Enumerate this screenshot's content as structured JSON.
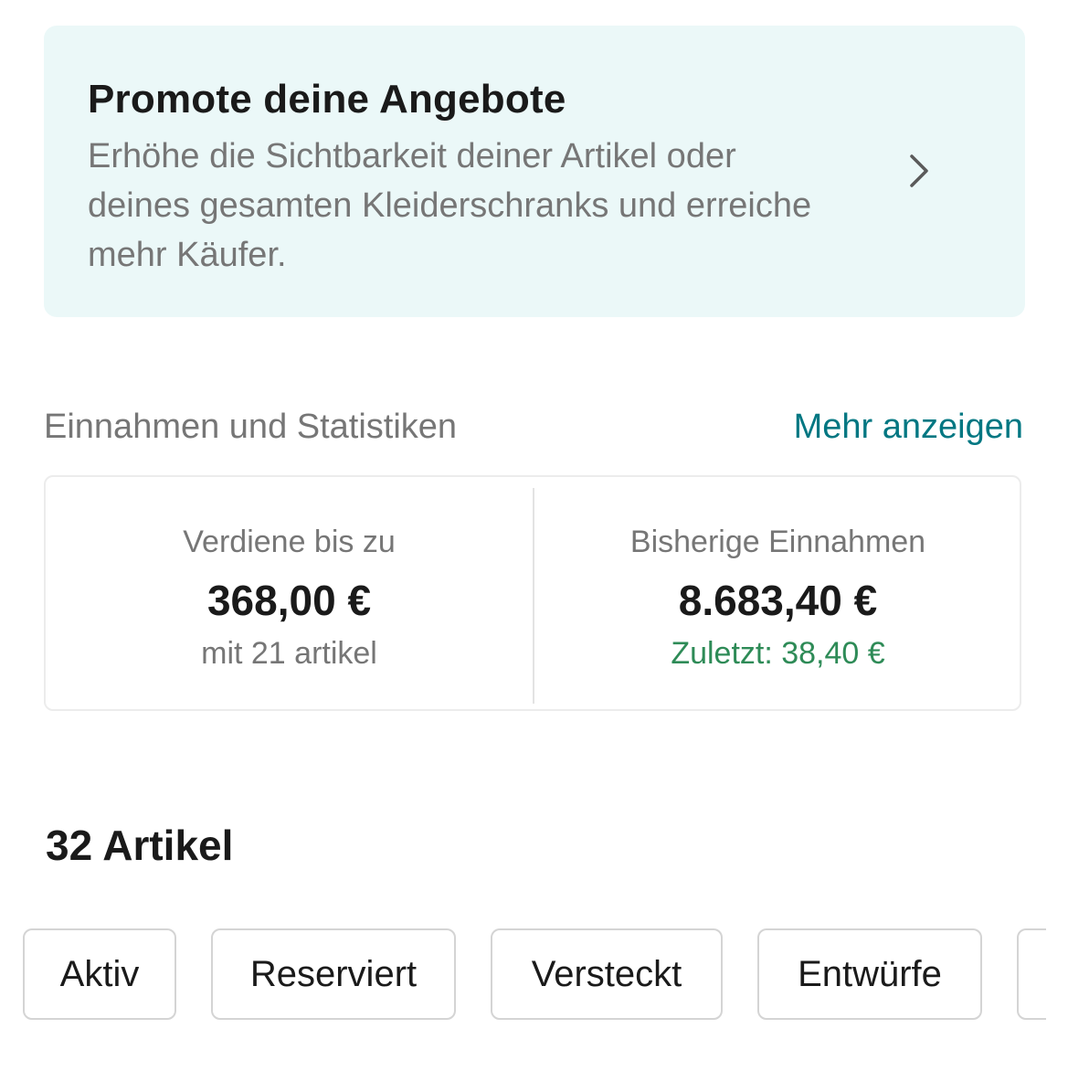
{
  "promo": {
    "title": "Promote deine Angebote",
    "description": "Erhöhe die Sichtbarkeit deiner Artikel oder deines gesamten Kleiderschranks und erreiche mehr Käufer.",
    "chevron_icon": "chevron-right-icon"
  },
  "stats_section": {
    "title": "Einnahmen und Statistiken",
    "more_link": "Mehr anzeigen",
    "earn": {
      "label": "Verdiene bis zu",
      "value": "368,00 €",
      "sub": "mit 21 artikel"
    },
    "earnings": {
      "label": "Bisherige Einnahmen",
      "value": "8.683,40 €",
      "sub": "Zuletzt: 38,40 €"
    }
  },
  "items": {
    "count_title": "32 Artikel",
    "filters": [
      {
        "label": "Aktiv"
      },
      {
        "label": "Reserviert"
      },
      {
        "label": "Versteckt"
      },
      {
        "label": "Entwürfe"
      },
      {
        "label": ""
      }
    ]
  },
  "colors": {
    "promo_background": "#ebf8f8",
    "link": "#007782",
    "positive": "#2e8b57",
    "muted_text": "#767676"
  }
}
